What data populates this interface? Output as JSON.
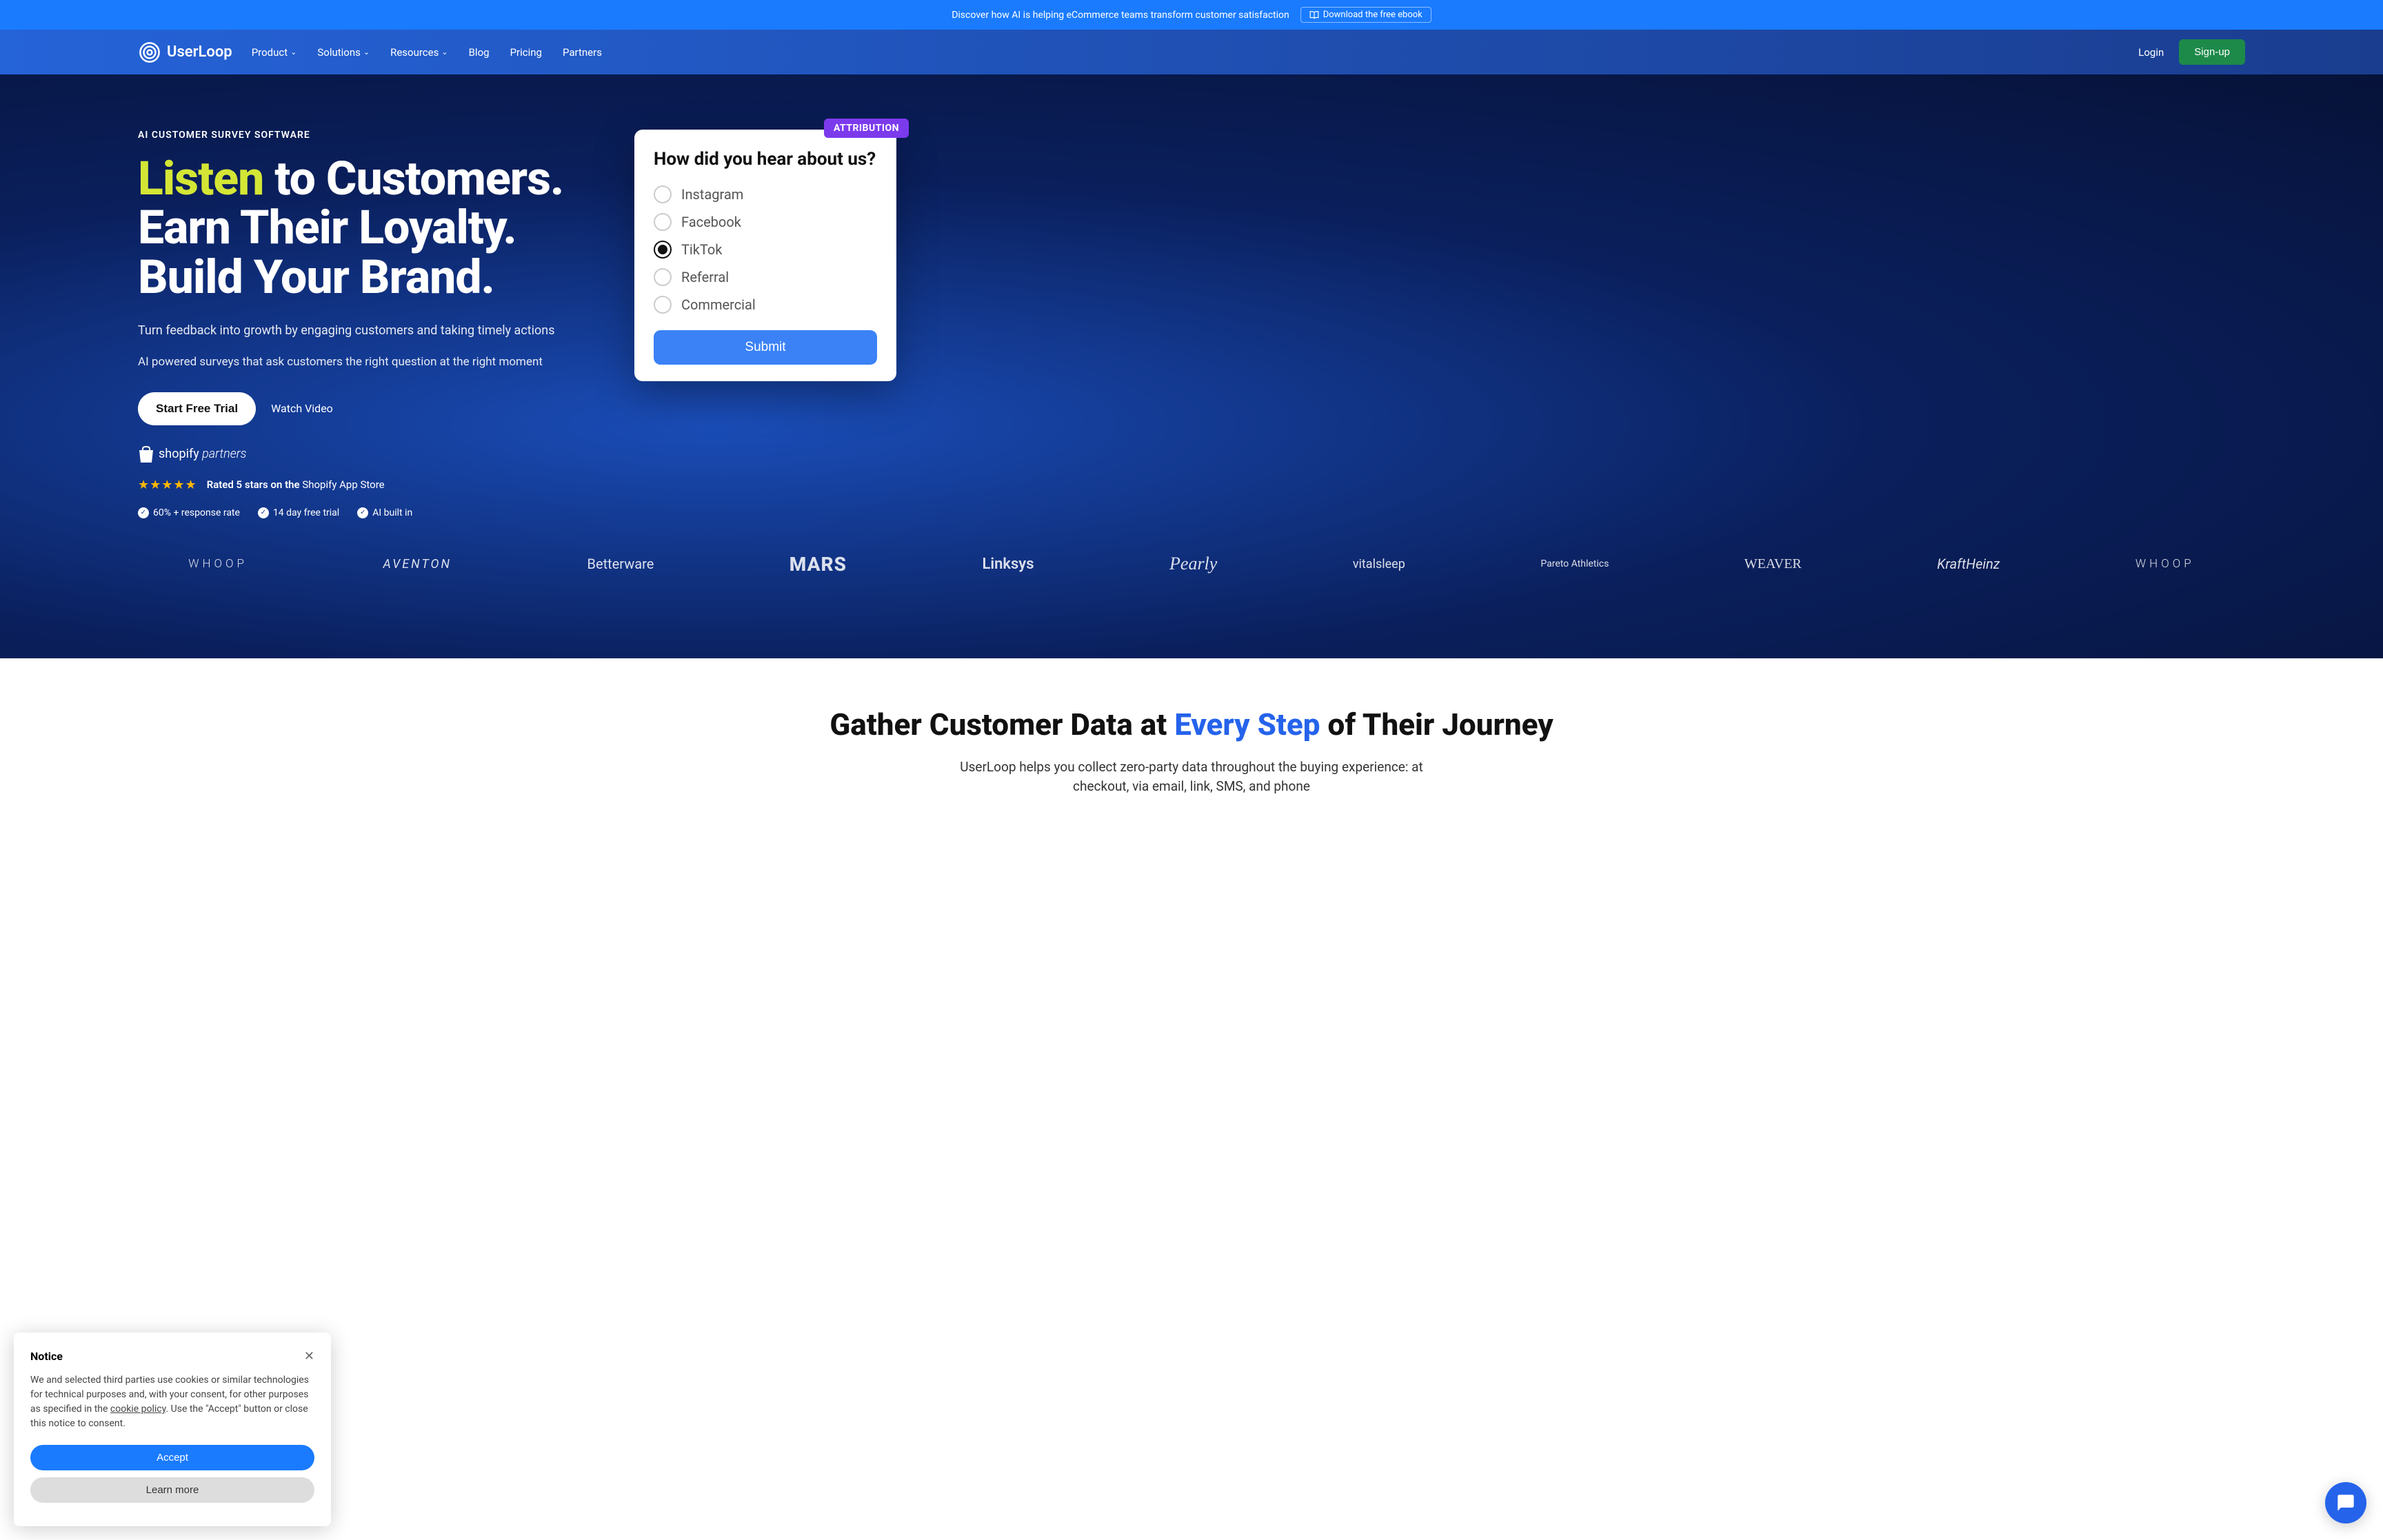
{
  "banner": {
    "text": "Discover how AI is helping eCommerce teams transform customer satisfaction",
    "cta": "Download the free ebook"
  },
  "nav": {
    "brand": "UserLoop",
    "items": [
      "Product",
      "Solutions",
      "Resources",
      "Blog",
      "Pricing",
      "Partners"
    ],
    "login": "Login",
    "signup": "Sign-up"
  },
  "hero": {
    "eyebrow": "AI CUSTOMER SURVEY SOFTWARE",
    "title_highlight": "Listen",
    "title_rest1": " to Customers.",
    "title_line2": "Earn Their Loyalty.",
    "title_line3": "Build Your Brand.",
    "subtitle": "Turn feedback into growth by engaging customers and taking timely actions",
    "subtitle2": "AI powered surveys that ask customers the right question at the right moment",
    "trial_cta": "Start Free Trial",
    "watch_cta": "Watch Video",
    "shopify_partners": "shopify partners",
    "rating_prefix": "Rated 5 stars on the ",
    "rating_store": "Shopify App Store",
    "features": [
      "60% + response rate",
      "14 day free trial",
      "AI built in"
    ]
  },
  "survey": {
    "badge": "ATTRIBUTION",
    "question": "How did you hear about us?",
    "options": [
      "Instagram",
      "Facebook",
      "TikTok",
      "Referral",
      "Commercial"
    ],
    "selected_index": 2,
    "submit": "Submit"
  },
  "brands": [
    "WHOOP",
    "AVENTON",
    "Betterware",
    "MARS",
    "Linksys",
    "Pearly",
    "vitalsleep",
    "Pareto Athletics",
    "WEAVER",
    "KraftHeinz",
    "WHOOP"
  ],
  "journey": {
    "title_pre": "Gather Customer Data at ",
    "title_blue": "Every Step",
    "title_post": " of Their Journey",
    "sub": "UserLoop helps you collect zero-party data throughout the buying experience: at checkout, via email, link, SMS, and phone"
  },
  "cookie": {
    "title": "Notice",
    "text_pre": "We and selected third parties use cookies or similar technologies for technical purposes and, with your consent, for other purposes as specified in the ",
    "link": "cookie policy",
    "text_post": ". Use the \"Accept\" button or close this notice to consent.",
    "accept": "Accept",
    "learn": "Learn more"
  }
}
